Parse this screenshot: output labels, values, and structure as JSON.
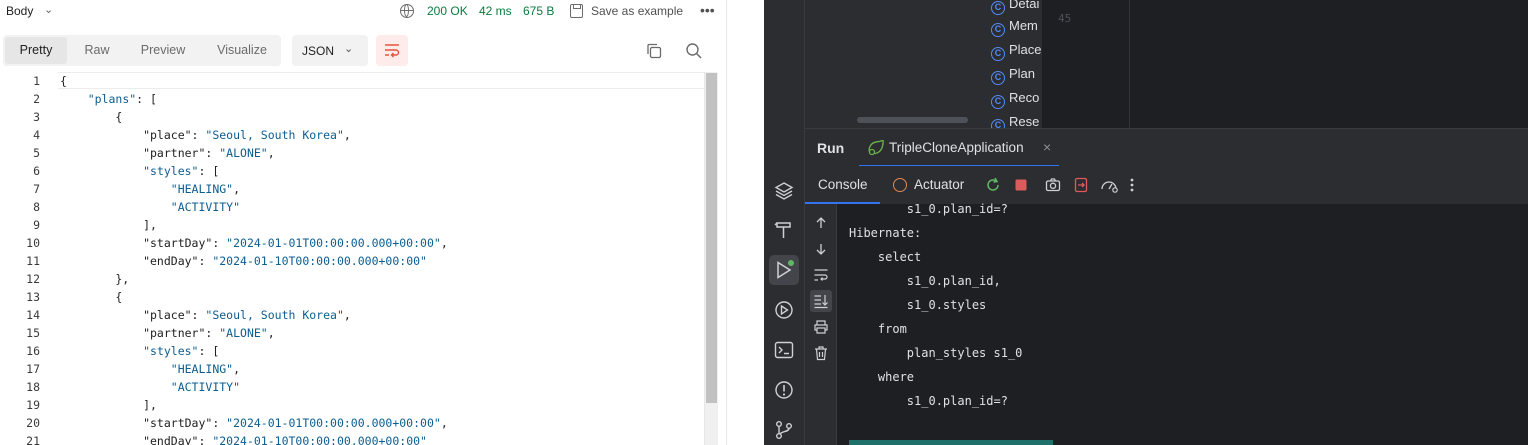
{
  "response": {
    "body_label": "Body",
    "status": "200 OK",
    "time": "42 ms",
    "size": "675 B",
    "save_label": "Save as example",
    "more_label": "•••",
    "view_tabs": [
      "Pretty",
      "Raw",
      "Preview",
      "Visualize"
    ],
    "active_tab": "Pretty",
    "format": "JSON",
    "line_numbers": [
      "1",
      "2",
      "3",
      "4",
      "5",
      "6",
      "7",
      "8",
      "9",
      "10",
      "11",
      "12",
      "13",
      "14",
      "15",
      "16",
      "17",
      "18",
      "19",
      "20",
      "21"
    ],
    "code_lines": [
      "{",
      "    \"plans\": [",
      "        {",
      "            \"place\": \"Seoul, South Korea\",",
      "            \"partner\": \"ALONE\",",
      "            \"styles\": [",
      "                \"HEALING\",",
      "                \"ACTIVITY\"",
      "            ],",
      "            \"startDay\": \"2024-01-01T00:00:00.000+00:00\",",
      "            \"endDay\": \"2024-01-10T00:00:00.000+00:00\"",
      "        },",
      "        {",
      "            \"place\": \"Seoul, South Korea\",",
      "            \"partner\": \"ALONE\",",
      "            \"styles\": [",
      "                \"HEALING\",",
      "                \"ACTIVITY\"",
      "            ],",
      "            \"startDay\": \"2024-01-01T00:00:00.000+00:00\",",
      "            \"endDay\": \"2024-01-10T00:00:00.000+00:00\""
    ]
  },
  "ide": {
    "project_tree": [
      "Detai",
      "Mem",
      "Place",
      "Plan",
      "Reco",
      "Rese"
    ],
    "editor_line_number": "45",
    "run_title": "Run",
    "run_config": "TripleCloneApplication",
    "close_glyph": "×",
    "console_tabs": [
      "Console",
      "Actuator"
    ],
    "console_lines": [
      "        s1_0.plan_id=?",
      "Hibernate:",
      "    select",
      "        s1_0.plan_id,",
      "        s1_0.styles",
      "    from",
      "        plan_styles s1_0",
      "    where",
      "        s1_0.plan_id=?"
    ],
    "colors": {
      "accent": "#3574f0",
      "status_ok": "#0b7a3e",
      "ide_bg": "#1e1f22",
      "ide_panel": "#2b2d30"
    }
  }
}
